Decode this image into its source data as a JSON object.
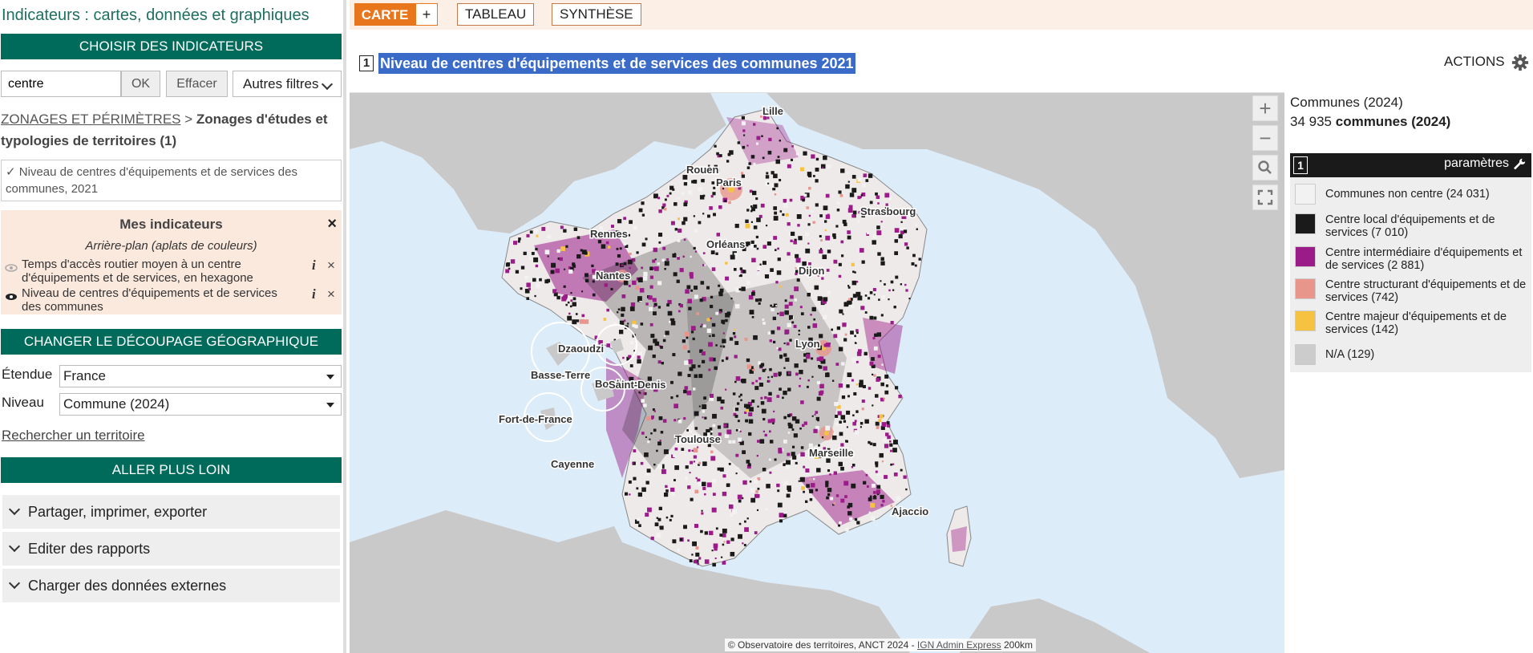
{
  "sidebar": {
    "title": "Indicateurs : cartes, données et graphiques",
    "choose_header": "CHOISIR DES INDICATEURS",
    "search": {
      "value": "centre",
      "ok": "OK",
      "clear": "Effacer",
      "filters": "Autres filtres"
    },
    "breadcrumb": {
      "link": "ZONAGES ET PÉRIMÈTRES",
      "sep": " > ",
      "current": "Zonages d'études et typologies de territoires (1)"
    },
    "selected_indicator": "✓ Niveau de centres d'équipements et de services des communes, 2021",
    "my_indicators": {
      "title": "Mes indicateurs",
      "close": "×",
      "subtitle": "Arrière-plan (aplats de couleurs)",
      "items": [
        {
          "label": "Temps d'accès routier moyen à un centre d'équipements et de services, en hexagone",
          "info": "i",
          "remove": "×",
          "visible": false
        },
        {
          "label": "Niveau de centres d'équipements et de services des communes",
          "info": "i",
          "remove": "×",
          "visible": true
        }
      ]
    },
    "geo_header": "CHANGER LE DÉCOUPAGE GÉOGRAPHIQUE",
    "extent": {
      "label": "Étendue",
      "value": "France"
    },
    "level": {
      "label": "Niveau",
      "value": "Commune (2024)"
    },
    "search_territory": "Rechercher un territoire",
    "further_header": "ALLER PLUS LOIN",
    "accordions": [
      "Partager, imprimer, exporter",
      "Editer des rapports",
      "Charger des données externes"
    ]
  },
  "tabs": {
    "carte": "CARTE",
    "plus": "+",
    "tableau": "TABLEAU",
    "synthese": "SYNTHÈSE"
  },
  "map_title": {
    "number": "1",
    "text": "Niveau de centres d'équipements et de services des communes 2021"
  },
  "actions_label": "ACTIONS",
  "zoom": {
    "in": "+",
    "out": "−"
  },
  "map_places": [
    "Lille",
    "Rouen",
    "Paris",
    "Strasbourg",
    "Rennes",
    "Orléans",
    "Nantes",
    "Dijon",
    "Lyon",
    "Bordeaux",
    "Toulouse",
    "Marseille",
    "Ajaccio",
    "Dzaoudzi",
    "Basse-Terre",
    "Saint-Denis",
    "Fort-de-France",
    "Cayenne"
  ],
  "attribution": {
    "text": "© Observatoire des territoires, ANCT 2024 - ",
    "link": "IGN Admin Express",
    "scale": "200km"
  },
  "legend": {
    "level": "Communes (2024)",
    "count": "34 935",
    "count_unit": "communes (2024)",
    "number": "1",
    "params": "paramètres",
    "items": [
      {
        "label": "Communes non centre (24 031)",
        "color": "#f2f2f2"
      },
      {
        "label": "Centre local d'équipements et de services (7 010)",
        "color": "#1a1a1a"
      },
      {
        "label": "Centre intermédiaire d'équipements et de services (2 881)",
        "color": "#9b1b88"
      },
      {
        "label": "Centre structurant d'équipements et de services (742)",
        "color": "#e8968b"
      },
      {
        "label": "Centre majeur d'équipements et de services (142)",
        "color": "#f5c242"
      },
      {
        "label": "N/A (129)",
        "color": "#cccccc"
      }
    ]
  }
}
